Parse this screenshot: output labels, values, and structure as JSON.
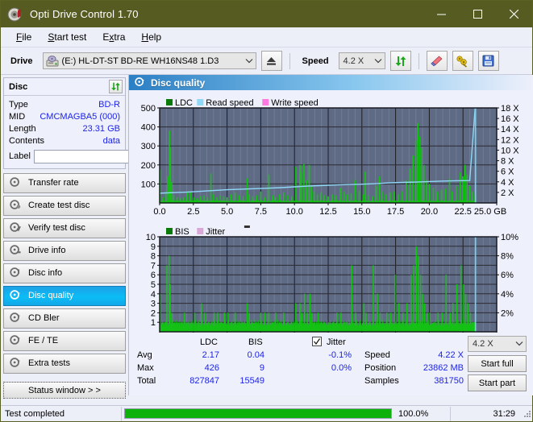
{
  "window": {
    "title": "Opti Drive Control 1.70",
    "icon": "disc-icon",
    "minimize": "─",
    "maximize": "☐",
    "close": "✕"
  },
  "menubar": {
    "items": [
      "File",
      "Start test",
      "Extra",
      "Help"
    ]
  },
  "toolbar": {
    "drive_label": "Drive",
    "drive_value": "(E:)  HL-DT-ST BD-RE  WH16NS48 1.D3",
    "eject_icon": "eject-icon",
    "speed_label": "Speed",
    "speed_value": "4.2 X",
    "refresh_icon": "refresh-icon",
    "erase_icon": "eraser-icon",
    "tools_icon": "wrench-icon",
    "save_icon": "floppy-save-icon"
  },
  "disc_panel": {
    "title": "Disc",
    "refresh_icon": "refresh-icon",
    "rows": [
      {
        "key": "Type",
        "value": "BD-R"
      },
      {
        "key": "MID",
        "value": "CMCMAGBA5 (000)"
      },
      {
        "key": "Length",
        "value": "23.31 GB"
      },
      {
        "key": "Contents",
        "value": "data"
      }
    ],
    "label_key": "Label",
    "label_value": "",
    "label_placeholder": "",
    "label_button_icon": "disc-icon"
  },
  "sidebar": {
    "items": [
      {
        "label": "Transfer rate",
        "icon": "disc-transfer-icon",
        "active": false
      },
      {
        "label": "Create test disc",
        "icon": "disc-create-icon",
        "active": false
      },
      {
        "label": "Verify test disc",
        "icon": "disc-verify-icon",
        "active": false
      },
      {
        "label": "Drive info",
        "icon": "disc-drive-icon",
        "active": false
      },
      {
        "label": "Disc info",
        "icon": "disc-info-icon",
        "active": false
      },
      {
        "label": "Disc quality",
        "icon": "disc-quality-icon",
        "active": true
      },
      {
        "label": "CD Bler",
        "icon": "disc-bler-icon",
        "active": false
      },
      {
        "label": "FE / TE",
        "icon": "disc-fete-icon",
        "active": false
      },
      {
        "label": "Extra tests",
        "icon": "disc-extra-icon",
        "active": false
      }
    ],
    "status_window_button": "Status window > >"
  },
  "content": {
    "header_title": "Disc quality",
    "header_icon": "disc-quality-icon"
  },
  "stats": {
    "col_ldc": "LDC",
    "col_bis": "BIS",
    "row_avg": "Avg",
    "row_max": "Max",
    "row_total": "Total",
    "ldc_avg": "2.17",
    "ldc_max": "426",
    "ldc_total": "827847",
    "bis_avg": "0.04",
    "bis_max": "9",
    "bis_total": "15549",
    "jitter_label": "Jitter",
    "jitter_checked": true,
    "jitter_avg": "-0.1%",
    "jitter_max": "0.0%",
    "speed_label": "Speed",
    "speed_value": "4.22 X",
    "position_label": "Position",
    "position_value": "23862 MB",
    "samples_label": "Samples",
    "samples_value": "381750",
    "speed_select": "4.2 X",
    "start_full": "Start full",
    "start_part": "Start part"
  },
  "statusbar": {
    "message": "Test completed",
    "progress_percent": "100.0%",
    "progress_value": 100,
    "elapsed": "31:29"
  },
  "colors": {
    "titlebar": "#565c21",
    "accent_blue": "#1d24e8",
    "chart_bg": "#5f6b85",
    "ldc_green": "#12c412",
    "read_speed": "#8fd8f7",
    "write_speed": "#ff7ae0",
    "jitter_pink": "#d9a8d9",
    "progress_green": "#0cb10c",
    "active_nav": "#0bbdf5"
  },
  "chart_data": [
    {
      "type": "line",
      "title": "LDC / Read speed",
      "xlabel": "GB",
      "ylabel": "LDC",
      "xlim": [
        0,
        25
      ],
      "ylim": [
        0,
        500
      ],
      "y2lim": [
        0,
        18
      ],
      "y2label": "X",
      "grid": true,
      "legend_position": "top-left",
      "legend": [
        {
          "name": "LDC",
          "color": "#0b7a0b"
        },
        {
          "name": "Read speed",
          "color": "#8fd8f7"
        },
        {
          "name": "Write speed",
          "color": "#ff7ae0"
        }
      ],
      "xticks": [
        "0.0",
        "2.5",
        "5.0",
        "7.5",
        "10.0",
        "12.5",
        "15.0",
        "17.5",
        "20.0",
        "22.5",
        "25.0 GB"
      ],
      "yticks": [
        "100",
        "200",
        "300",
        "400",
        "500"
      ],
      "y2ticks": [
        "2 X",
        "4 X",
        "6 X",
        "8 X",
        "10 X",
        "12 X",
        "14 X",
        "16 X",
        "18 X"
      ],
      "series": [
        {
          "name": "LDC",
          "color": "#12c412",
          "axis": "left",
          "x": [
            0.05,
            0.25,
            0.45,
            0.6,
            0.72,
            0.8,
            0.9,
            1.05,
            1.3,
            1.55,
            1.8,
            2.05,
            2.3,
            2.55,
            2.8,
            3.05,
            3.3,
            3.55,
            3.8,
            4.0,
            4.25,
            4.5,
            4.75,
            5.0,
            5.3,
            5.6,
            5.9,
            6.2,
            6.5,
            6.65,
            6.9,
            7.2,
            7.5,
            7.8,
            8.1,
            8.4,
            8.6,
            8.9,
            9.2,
            9.5,
            9.8,
            10.1,
            10.4,
            10.5,
            10.7,
            10.9,
            11.1,
            11.25,
            11.45,
            11.7,
            11.95,
            12.2,
            12.5,
            12.8,
            13.1,
            13.4,
            13.7,
            13.9,
            14.2,
            14.5,
            14.8,
            15.1,
            15.25,
            15.5,
            15.8,
            16.1,
            16.3,
            16.5,
            16.8,
            17.1,
            17.4,
            17.7,
            18.0,
            18.3,
            18.6,
            18.8,
            19.0,
            19.15,
            19.3,
            19.45,
            19.6,
            19.8,
            20.0,
            20.3,
            20.6,
            20.9,
            21.2,
            21.5,
            21.7,
            22.0,
            22.3,
            22.5,
            22.65,
            22.8,
            23.0,
            23.2,
            23.4
          ],
          "y": [
            175,
            30,
            60,
            140,
            380,
            290,
            110,
            40,
            30,
            25,
            30,
            55,
            60,
            30,
            25,
            35,
            40,
            30,
            155,
            45,
            30,
            40,
            35,
            30,
            45,
            55,
            40,
            35,
            130,
            45,
            35,
            40,
            60,
            30,
            150,
            40,
            30,
            45,
            55,
            40,
            35,
            190,
            200,
            160,
            205,
            120,
            200,
            90,
            60,
            45,
            55,
            40,
            35,
            45,
            40,
            80,
            60,
            45,
            50,
            120,
            65,
            45,
            165,
            40,
            35,
            90,
            140,
            60,
            45,
            55,
            60,
            45,
            60,
            120,
            180,
            250,
            330,
            420,
            350,
            290,
            200,
            120,
            100,
            80,
            60,
            70,
            75,
            130,
            60,
            90,
            160,
            140,
            200,
            150,
            90,
            60,
            40
          ]
        },
        {
          "name": "Read speed",
          "color": "#8fd8f7",
          "axis": "right",
          "x": [
            0.0,
            1.0,
            2.0,
            3.0,
            4.0,
            5.0,
            6.0,
            7.0,
            8.0,
            9.0,
            10.0,
            11.0,
            12.0,
            13.0,
            14.0,
            15.0,
            16.0,
            17.0,
            18.0,
            19.0,
            20.0,
            21.0,
            22.0,
            23.0,
            23.4
          ],
          "y": [
            1.85,
            1.95,
            2.05,
            2.2,
            2.35,
            2.5,
            2.6,
            2.7,
            2.8,
            2.9,
            3.05,
            3.2,
            3.3,
            3.4,
            3.5,
            3.55,
            3.65,
            3.8,
            3.9,
            3.95,
            4.05,
            4.15,
            4.2,
            4.25,
            18.0
          ]
        },
        {
          "name": "Write speed",
          "color": "#ff7ae0",
          "axis": "right",
          "x": [],
          "y": []
        }
      ]
    },
    {
      "type": "line",
      "title": "BIS / Jitter",
      "xlabel": "GB",
      "ylabel": "BIS",
      "xlim": [
        0,
        25
      ],
      "ylim": [
        0,
        10
      ],
      "y2lim": [
        0,
        10
      ],
      "y2label": "%",
      "grid": true,
      "legend_position": "top-left",
      "legend": [
        {
          "name": "BIS",
          "color": "#0b7a0b"
        },
        {
          "name": "Jitter",
          "color": "#d9a8d9"
        }
      ],
      "xticks": [
        "0.0",
        "2.5",
        "5.0",
        "7.5",
        "10.0",
        "12.5",
        "15.0",
        "17.5",
        "20.0",
        "22.5",
        "25.0 GB"
      ],
      "yticks": [
        "1",
        "2",
        "3",
        "4",
        "5",
        "6",
        "7",
        "8",
        "9",
        "10"
      ],
      "y2ticks": [
        "2%",
        "4%",
        "6%",
        "8%",
        "10%"
      ],
      "series": [
        {
          "name": "BIS",
          "color": "#12c412",
          "axis": "left",
          "x": [
            0.05,
            0.2,
            0.4,
            0.55,
            0.7,
            0.78,
            0.9,
            1.1,
            1.35,
            1.6,
            1.85,
            2.1,
            2.35,
            2.6,
            2.85,
            3.1,
            3.35,
            3.6,
            3.85,
            4.05,
            4.3,
            4.55,
            4.8,
            5.05,
            5.3,
            5.6,
            5.9,
            6.2,
            6.5,
            6.65,
            6.9,
            7.2,
            7.5,
            7.8,
            8.1,
            8.4,
            8.6,
            8.9,
            9.2,
            9.5,
            9.8,
            10.1,
            10.4,
            10.55,
            10.75,
            10.95,
            11.15,
            11.3,
            11.5,
            11.75,
            12.0,
            12.25,
            12.55,
            12.85,
            13.15,
            13.45,
            13.75,
            13.95,
            14.25,
            14.55,
            14.85,
            15.15,
            15.3,
            15.55,
            15.85,
            16.15,
            16.35,
            16.55,
            16.85,
            17.15,
            17.45,
            17.75,
            18.05,
            18.35,
            18.65,
            18.85,
            19.05,
            19.2,
            19.35,
            19.5,
            19.65,
            19.85,
            20.05,
            20.35,
            20.65,
            20.95,
            21.25,
            21.55,
            21.75,
            22.05,
            22.35,
            22.55,
            22.7,
            22.85,
            23.05,
            23.25,
            23.4
          ],
          "y": [
            4,
            1,
            1,
            7,
            8,
            5,
            2,
            1,
            1,
            1,
            2,
            1,
            1,
            2,
            1,
            3,
            2,
            1,
            1,
            2,
            2,
            1,
            2,
            2,
            1,
            2,
            1,
            1,
            3,
            2,
            1,
            1,
            2,
            2,
            2,
            1,
            2,
            1,
            2,
            1,
            1,
            3,
            3,
            2,
            4,
            2,
            4,
            2,
            1,
            2,
            1,
            1,
            1,
            1,
            2,
            2,
            1,
            1,
            7,
            2,
            1,
            3,
            2,
            1,
            7,
            4,
            2,
            1,
            2,
            2,
            6,
            3,
            2,
            3,
            6,
            7,
            9,
            8,
            6,
            4,
            3,
            2,
            2,
            1,
            2,
            2,
            6,
            2,
            3,
            5,
            7,
            5,
            4,
            3,
            2,
            1,
            1
          ]
        },
        {
          "name": "Jitter",
          "color": "#d9a8d9",
          "axis": "right",
          "x": [],
          "y": []
        }
      ]
    }
  ]
}
